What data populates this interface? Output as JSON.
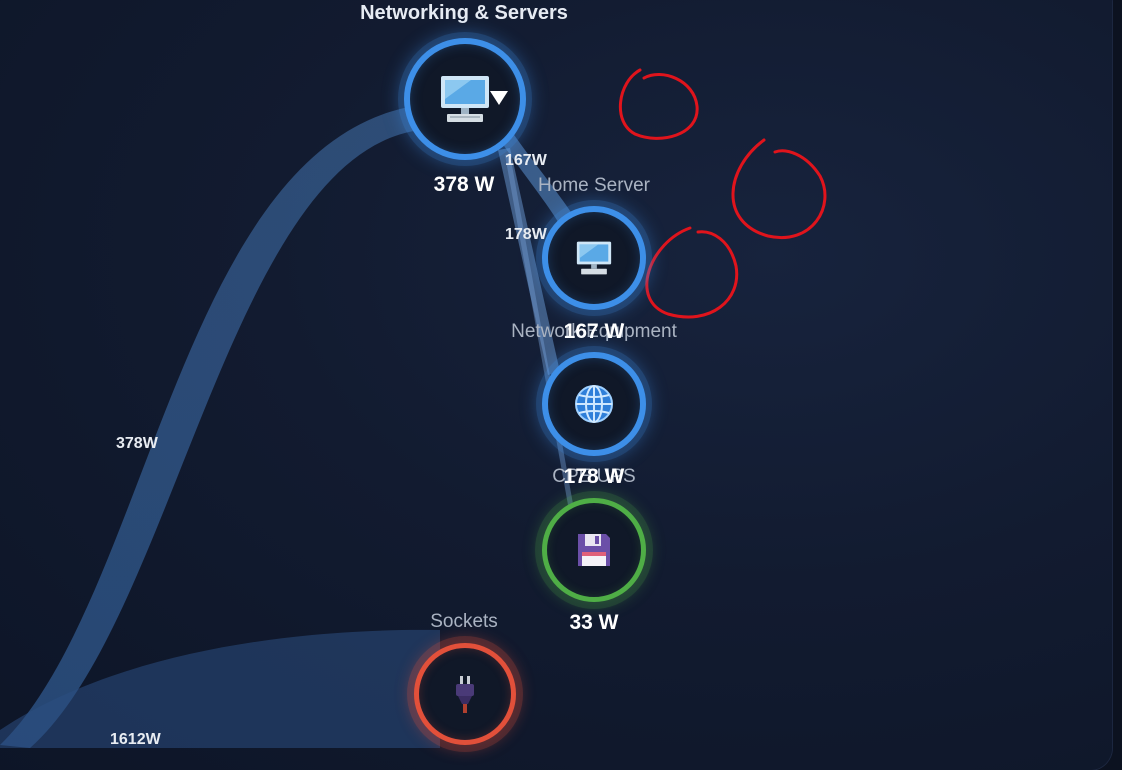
{
  "nodes": {
    "networking": {
      "name": "Networking & Servers",
      "power": "378 W",
      "icon": "computer-monitor-icon",
      "color": "#3d8fe8"
    },
    "home_server": {
      "name": "Home Server",
      "power": "167 W",
      "icon": "computer-monitor-icon",
      "color": "#3d8fe8"
    },
    "network_equipment": {
      "name": "Network Equipment",
      "power": "178 W",
      "icon": "globe-icon",
      "color": "#3d8fe8"
    },
    "ups": {
      "name": "CPE UPS",
      "power": "33 W",
      "icon": "floppy-disk-icon",
      "color": "#4fae46"
    },
    "sockets": {
      "name": "Sockets",
      "icon": "plug-icon",
      "color": "#e2503a"
    }
  },
  "flows": {
    "to_networking": "378W",
    "to_home_server": "167W",
    "to_network_equipment": "178W",
    "to_sockets": "1612W"
  },
  "annotations": {
    "color": "#e0141c",
    "count": 3
  }
}
